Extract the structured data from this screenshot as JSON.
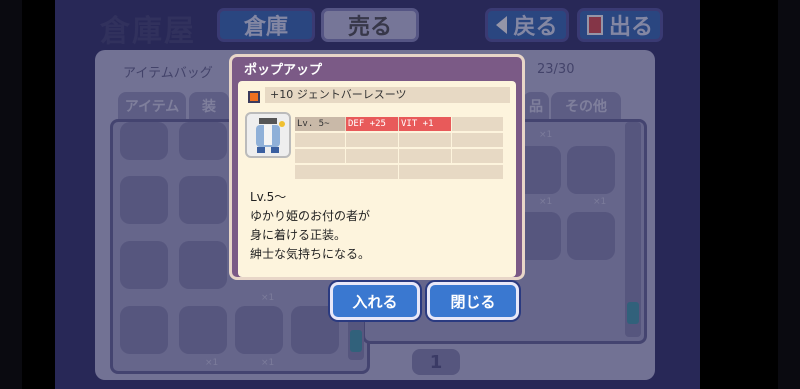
{
  "header": {
    "title": "倉庫屋",
    "tab_storage": "倉庫",
    "tab_sell": "売る",
    "back_label": "戻る",
    "exit_label": "出る"
  },
  "background": {
    "bag_label": "アイテムバッグ",
    "capacity": "23/30",
    "tabs": [
      "アイテム",
      "装",
      "品",
      "その他"
    ],
    "stack_count": "×1",
    "page": "1"
  },
  "popup": {
    "title": "ポップアップ",
    "item_name": "+10 ジェントバーレスーツ",
    "stats": {
      "level": "Lv.  5~",
      "def": "DEF  +25",
      "vit": "VIT   +1"
    },
    "description_lines": [
      "Lv.5～",
      "ゆかり姫のお付の者が",
      "身に着ける正装。",
      "紳士な気持ちになる。"
    ],
    "put_in_button": "入れる",
    "close_button": "閉じる"
  },
  "colors": {
    "accent_blue": "#3a78d0",
    "popup_frame": "#7b5a86",
    "stat_highlight": "#e85a5a"
  }
}
